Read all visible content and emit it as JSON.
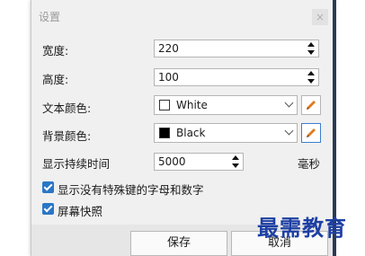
{
  "window": {
    "title": "设置",
    "close_glyph": "×"
  },
  "fields": {
    "width": {
      "label": "宽度:",
      "value": "220"
    },
    "height": {
      "label": "高度:",
      "value": "100"
    },
    "text_color": {
      "label": "文本颜色:",
      "value": "White",
      "swatch": "#ffffff"
    },
    "bg_color": {
      "label": "背景颜色:",
      "value": "Black",
      "swatch": "#000000"
    },
    "duration": {
      "label": "显示持续时间",
      "value": "5000",
      "unit": "毫秒"
    }
  },
  "options": {
    "show_letters": {
      "label": "显示没有特殊键的字母和数字",
      "checked": true
    },
    "screen_flash": {
      "label": "屏幕快照",
      "checked": true
    }
  },
  "buttons": {
    "save": "保存",
    "cancel": "取消"
  },
  "watermark": "最需教育",
  "colors": {
    "accent": "#2a76c6",
    "pencil": "#e07a1f",
    "watermark": "#1d3fa3"
  }
}
